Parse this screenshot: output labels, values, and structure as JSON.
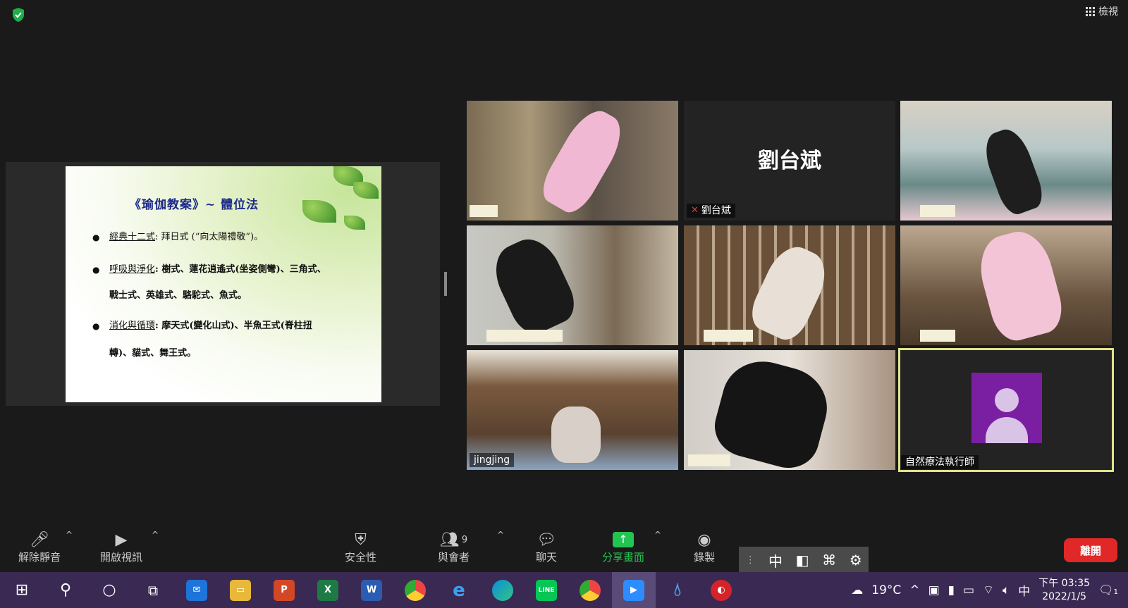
{
  "top": {
    "view_label": "檢視"
  },
  "slide": {
    "title": "《瑜伽教案》~ 體位法",
    "bullets": [
      {
        "key": "經典十二式",
        "text": ": 拜日式 (“向太陽禮敬”)。",
        "cont": ""
      },
      {
        "key": "呼吸與淨化",
        "text": ": 樹式、蓮花逍遙式(坐姿側彎)、三角式、",
        "cont": "戰士式、英雄式、駱駝式、魚式。"
      },
      {
        "key": "消化與循環",
        "text": ": 摩天式(變化山式)、半魚王式(脊柱扭",
        "cont": "轉)、貓式、舞王式。"
      }
    ]
  },
  "participants": {
    "liu_name": "劉台斌",
    "jingjing_name": "jingjing",
    "host_name": "自然療法執行師"
  },
  "toolbar": {
    "unmute": "解除靜音",
    "start_video": "開啟視訊",
    "security": "安全性",
    "participants": "與會者",
    "participant_count": "9",
    "chat": "聊天",
    "share": "分享畫面",
    "record": "錄製",
    "leave": "離開"
  },
  "ime": {
    "mode": "中"
  },
  "taskbar": {
    "weather": "19°C",
    "ime": "中",
    "time": "下午 03:35",
    "date": "2022/1/5",
    "notif_count": "1"
  },
  "colors": {
    "leave": "#e02828",
    "share_green": "#23c552",
    "active_border": "#e0e38a",
    "avatar": "#7a1fa2"
  }
}
